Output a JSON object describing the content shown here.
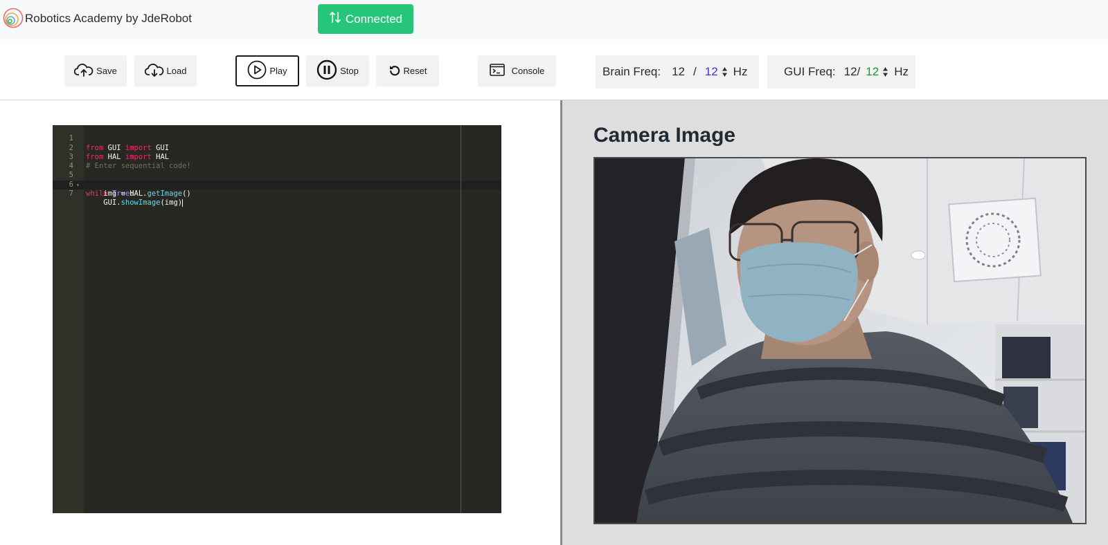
{
  "navbar": {
    "brand": "Robotics Academy by JdeRobot",
    "logo_icon": "concentric-rings-logo",
    "connection_status": "Connected",
    "connection_color": "#27c57a"
  },
  "toolbar": {
    "save": "Save",
    "load": "Load",
    "play": "Play",
    "stop": "Stop",
    "reset": "Reset",
    "console": "Console",
    "brain_freq": {
      "label": "Brain Freq:",
      "measured": "12",
      "separator": "/",
      "target": "12",
      "unit": "Hz"
    },
    "gui_freq": {
      "label": "GUI Freq:",
      "measured": "12/",
      "target": "12",
      "unit": "Hz"
    }
  },
  "editor": {
    "theme": "monokai",
    "line_numbers": [
      "1",
      "2",
      "3",
      "4",
      "5",
      "6",
      "7"
    ],
    "lines": {
      "l1": [
        "from",
        " GUI ",
        "import",
        " GUI"
      ],
      "l2": [
        "from",
        " HAL ",
        "import",
        " HAL"
      ],
      "l3": "# Enter sequential code!",
      "l5": [
        "while",
        " ",
        "True",
        ":"
      ],
      "l6": [
        "    img = HAL.",
        "getImage",
        "()"
      ],
      "l7": [
        "    GUI.",
        "showImage",
        "(img)"
      ]
    }
  },
  "camera": {
    "title": "Camera Image",
    "content": "webcam-photo"
  }
}
